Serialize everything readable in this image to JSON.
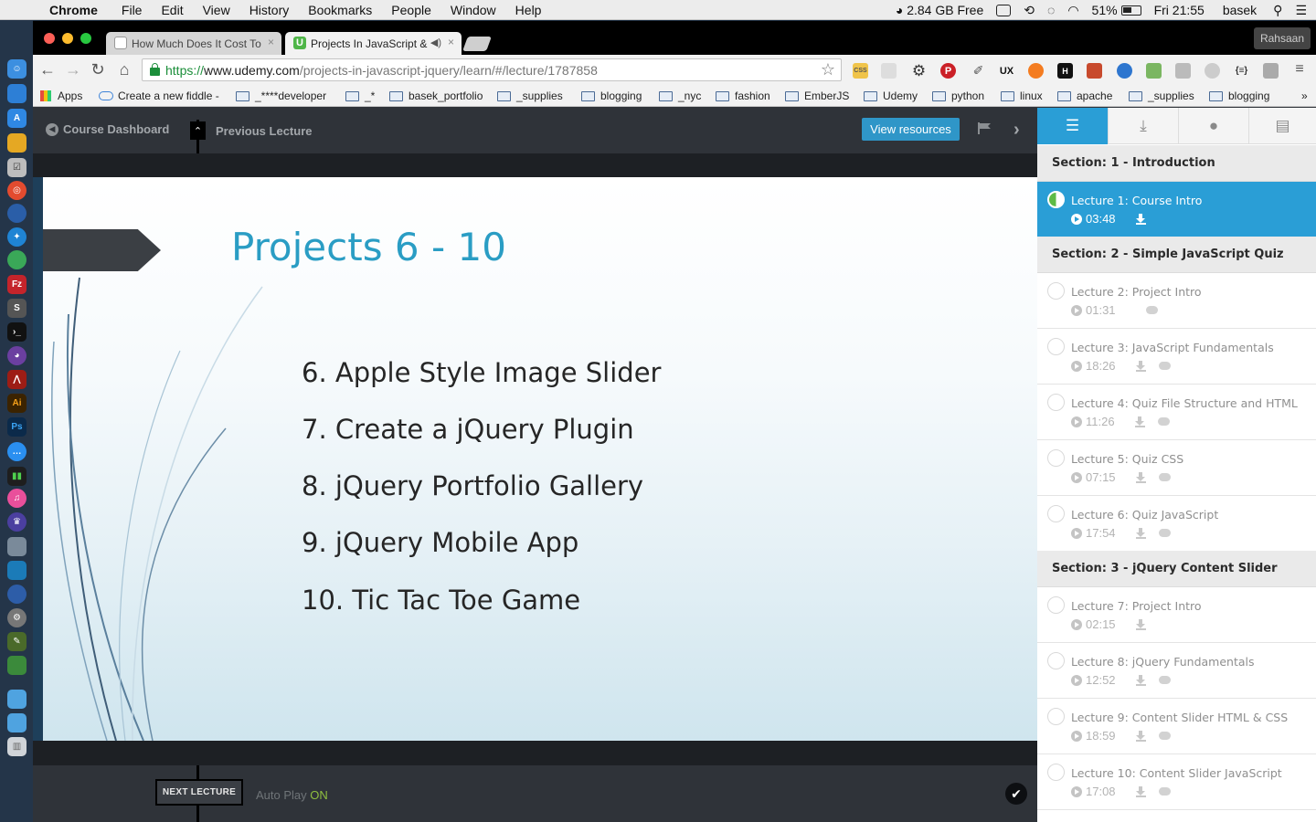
{
  "menubar": {
    "items": [
      "Chrome",
      "File",
      "Edit",
      "View",
      "History",
      "Bookmarks",
      "People",
      "Window",
      "Help"
    ],
    "memory": "2.84 GB Free",
    "battery": "51%",
    "clock": "Fri 21:55",
    "user": "basek"
  },
  "dock": {
    "icons": [
      "finder-icon",
      "app-store-icon",
      "stack-icon",
      "calendar-icon",
      "chrome-icon",
      "firefox-icon",
      "safari-icon",
      "globe-icon",
      "filezilla-icon",
      "sublime-icon",
      "terminal-icon",
      "github-icon",
      "acrobat-icon",
      "illustrator-icon",
      "photoshop-icon",
      "messages-icon",
      "meter-icon",
      "itunes-icon",
      "alfred-icon",
      "preview-icon",
      "quicktime-icon",
      "spotlight-icon",
      "system-preferences-icon",
      "pencil-icon",
      "network-icon",
      "downloads-folder-icon",
      "documents-folder-icon",
      "trash-icon"
    ]
  },
  "browser": {
    "profile": "Rahsaan",
    "tabs": [
      {
        "title": "How Much Does It Cost To",
        "active": false
      },
      {
        "title": "Projects In JavaScript &",
        "active": true
      }
    ],
    "url": {
      "scheme": "https://",
      "host": "www.udemy.com",
      "path": "/projects-in-javascript-jquery/learn/#/lecture/1787858"
    },
    "bookmarks": [
      "Apps",
      "Create a new fiddle -",
      "_****developer",
      "_*",
      "basek_portfolio",
      "_supplies",
      "blogging",
      "_nyc",
      "fashion",
      "EmberJS",
      "Udemy",
      "python",
      "linux",
      "apache",
      "_supplies",
      "blogging"
    ],
    "more_bookmarks": "»"
  },
  "player": {
    "course_dashboard": "Course Dashboard",
    "previous_lecture": "Previous Lecture",
    "view_resources": "View resources",
    "next_lecture": "NEXT LECTURE",
    "autoplay_label": "Auto Play",
    "autoplay_state": "ON"
  },
  "slide": {
    "title": "Projects 6 - 10",
    "items": [
      "6. Apple Style Image Slider",
      "7. Create a jQuery Plugin",
      "8. jQuery Portfolio Gallery",
      "9. jQuery Mobile App",
      "10. Tic Tac Toe Game"
    ]
  },
  "sidebar": {
    "sections": [
      {
        "title": "Section: 1 - Introduction",
        "lectures": [
          {
            "title": "Lecture 1: Course Intro",
            "duration": "03:48",
            "download": true,
            "comments": false,
            "current": true
          }
        ]
      },
      {
        "title": "Section: 2 - Simple JavaScript Quiz",
        "lectures": [
          {
            "title": "Lecture 2: Project Intro",
            "duration": "01:31",
            "download": false,
            "comments": true
          },
          {
            "title": "Lecture 3: JavaScript Fundamentals",
            "duration": "18:26",
            "download": true,
            "comments": true
          },
          {
            "title": "Lecture 4: Quiz File Structure and HTML",
            "duration": "11:26",
            "download": true,
            "comments": true
          },
          {
            "title": "Lecture 5: Quiz CSS",
            "duration": "07:15",
            "download": true,
            "comments": true
          },
          {
            "title": "Lecture 6: Quiz JavaScript",
            "duration": "17:54",
            "download": true,
            "comments": true
          }
        ]
      },
      {
        "title": "Section: 3 - jQuery Content Slider",
        "lectures": [
          {
            "title": "Lecture 7: Project Intro",
            "duration": "02:15",
            "download": true,
            "comments": false
          },
          {
            "title": "Lecture 8: jQuery Fundamentals",
            "duration": "12:52",
            "download": true,
            "comments": true
          },
          {
            "title": "Lecture 9: Content Slider HTML & CSS",
            "duration": "18:59",
            "download": true,
            "comments": true
          },
          {
            "title": "Lecture 10: Content Slider JavaScript",
            "duration": "17:08",
            "download": true,
            "comments": true
          }
        ]
      }
    ]
  }
}
